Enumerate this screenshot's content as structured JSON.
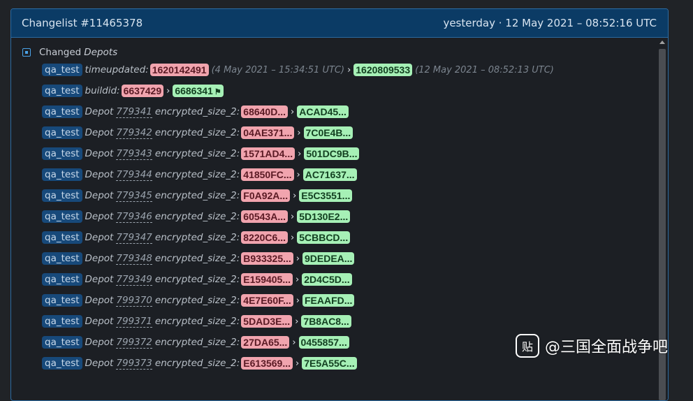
{
  "header": {
    "title": "Changelist #11465378",
    "time": "yesterday · 12 May 2021 – 08:52:16 UTC"
  },
  "section": {
    "label_plain": "Changed",
    "label_em": "Depots"
  },
  "rows_top": [
    {
      "tag": "qa_test",
      "label": "timeupdated:",
      "old": "1620142491",
      "old_ts": "(4 May 2021 – 15:34:51 UTC)",
      "arrow": "›",
      "new": "1620809533",
      "new_ts": "(12 May 2021 – 08:52:13 UTC)"
    },
    {
      "tag": "qa_test",
      "label": "buildid:",
      "old": "6637429",
      "arrow": "›",
      "new": "6686341",
      "new_icon": "flag-icon"
    }
  ],
  "depot_rows": [
    {
      "tag": "qa_test",
      "depot_word": "Depot",
      "depot": "779341",
      "key": "encrypted_size_2:",
      "old": "68640D...",
      "arrow": "›",
      "new": "ACAD45..."
    },
    {
      "tag": "qa_test",
      "depot_word": "Depot",
      "depot": "779342",
      "key": "encrypted_size_2:",
      "old": "04AE371...",
      "arrow": "›",
      "new": "7C0E4B..."
    },
    {
      "tag": "qa_test",
      "depot_word": "Depot",
      "depot": "779343",
      "key": "encrypted_size_2:",
      "old": "1571AD4...",
      "arrow": "›",
      "new": "501DC9B..."
    },
    {
      "tag": "qa_test",
      "depot_word": "Depot",
      "depot": "779344",
      "key": "encrypted_size_2:",
      "old": "41850FC...",
      "arrow": "›",
      "new": "AC71637..."
    },
    {
      "tag": "qa_test",
      "depot_word": "Depot",
      "depot": "779345",
      "key": "encrypted_size_2:",
      "old": "F0A92A...",
      "arrow": "›",
      "new": "E5C3551..."
    },
    {
      "tag": "qa_test",
      "depot_word": "Depot",
      "depot": "779346",
      "key": "encrypted_size_2:",
      "old": "60543A...",
      "arrow": "›",
      "new": "5D130E2..."
    },
    {
      "tag": "qa_test",
      "depot_word": "Depot",
      "depot": "779347",
      "key": "encrypted_size_2:",
      "old": "8220C6...",
      "arrow": "›",
      "new": "5CBBCD..."
    },
    {
      "tag": "qa_test",
      "depot_word": "Depot",
      "depot": "779348",
      "key": "encrypted_size_2:",
      "old": "B933325...",
      "arrow": "›",
      "new": "9DEDEA..."
    },
    {
      "tag": "qa_test",
      "depot_word": "Depot",
      "depot": "779349",
      "key": "encrypted_size_2:",
      "old": "E159405...",
      "arrow": "›",
      "new": "2D4C5D..."
    },
    {
      "tag": "qa_test",
      "depot_word": "Depot",
      "depot": "799370",
      "key": "encrypted_size_2:",
      "old": "4E7E60F...",
      "arrow": "›",
      "new": "FEAAFD..."
    },
    {
      "tag": "qa_test",
      "depot_word": "Depot",
      "depot": "799371",
      "key": "encrypted_size_2:",
      "old": "5DAD3E...",
      "arrow": "›",
      "new": "7B8AC8..."
    },
    {
      "tag": "qa_test",
      "depot_word": "Depot",
      "depot": "799372",
      "key": "encrypted_size_2:",
      "old": "27DA65...",
      "arrow": "›",
      "new": "0455857..."
    },
    {
      "tag": "qa_test",
      "depot_word": "Depot",
      "depot": "799373",
      "key": "encrypted_size_2:",
      "old": "E613569...",
      "arrow": "›",
      "new": "7E5A55C..."
    }
  ],
  "watermark": {
    "logo": "贴",
    "text": "@三国全面战争吧"
  },
  "colors": {
    "header_bg": "#0b3b65",
    "tag_bg": "#17497a",
    "old_bg": "#f1a4ae",
    "new_bg": "#a6f0b6",
    "accent": "#4ba3e8"
  }
}
